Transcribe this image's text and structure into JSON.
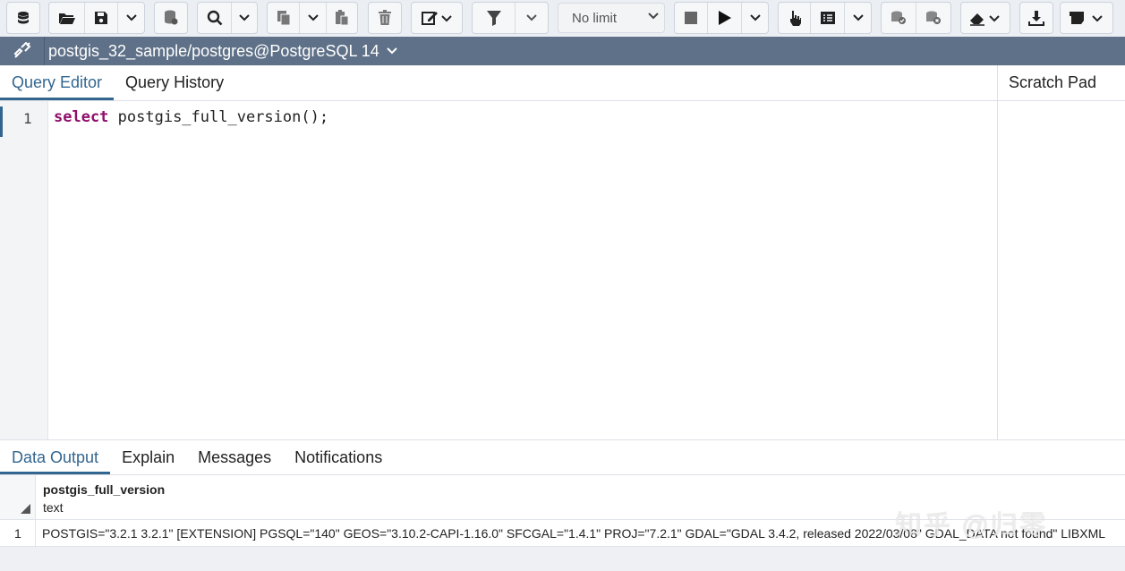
{
  "toolbar": {
    "limit_value": "No limit",
    "icons": [
      "database-icon",
      "folder-open-icon",
      "save-icon",
      "chevron-down-icon",
      "database-stack-icon",
      "search-icon",
      "copy-icon",
      "paste-icon",
      "delete-icon",
      "edit-icon",
      "filter-icon",
      "stop-icon",
      "play-icon",
      "pointer-icon",
      "list-icon",
      "commit-icon",
      "rollback-icon",
      "eraser-icon",
      "download-icon",
      "macro-icon"
    ]
  },
  "connection": {
    "title": "postgis_32_sample/postgres@PostgreSQL 14"
  },
  "editor_tabs": [
    {
      "label": "Query Editor",
      "active": true
    },
    {
      "label": "Query History",
      "active": false
    }
  ],
  "scratch_pad": {
    "label": "Scratch Pad"
  },
  "editor": {
    "line_number": "1",
    "keyword": "select",
    "rest": " postgis_full_version();"
  },
  "output_tabs": [
    {
      "label": "Data Output",
      "active": true
    },
    {
      "label": "Explain",
      "active": false
    },
    {
      "label": "Messages",
      "active": false
    },
    {
      "label": "Notifications",
      "active": false
    }
  ],
  "grid": {
    "column": {
      "name": "postgis_full_version",
      "type": "text"
    },
    "rows": [
      {
        "num": "1",
        "value": "POSTGIS=\"3.2.1 3.2.1\" [EXTENSION] PGSQL=\"140\" GEOS=\"3.10.2-CAPI-1.16.0\" SFCGAL=\"1.4.1\" PROJ=\"7.2.1\" GDAL=\"GDAL 3.4.2, released 2022/03/08\" GDAL_DATA not found\" LIBXML"
      }
    ]
  },
  "watermark": "知乎 @归零",
  "colors": {
    "accent": "#326690",
    "connbar": "#5f7188",
    "keyword": "#8f0f6b"
  }
}
